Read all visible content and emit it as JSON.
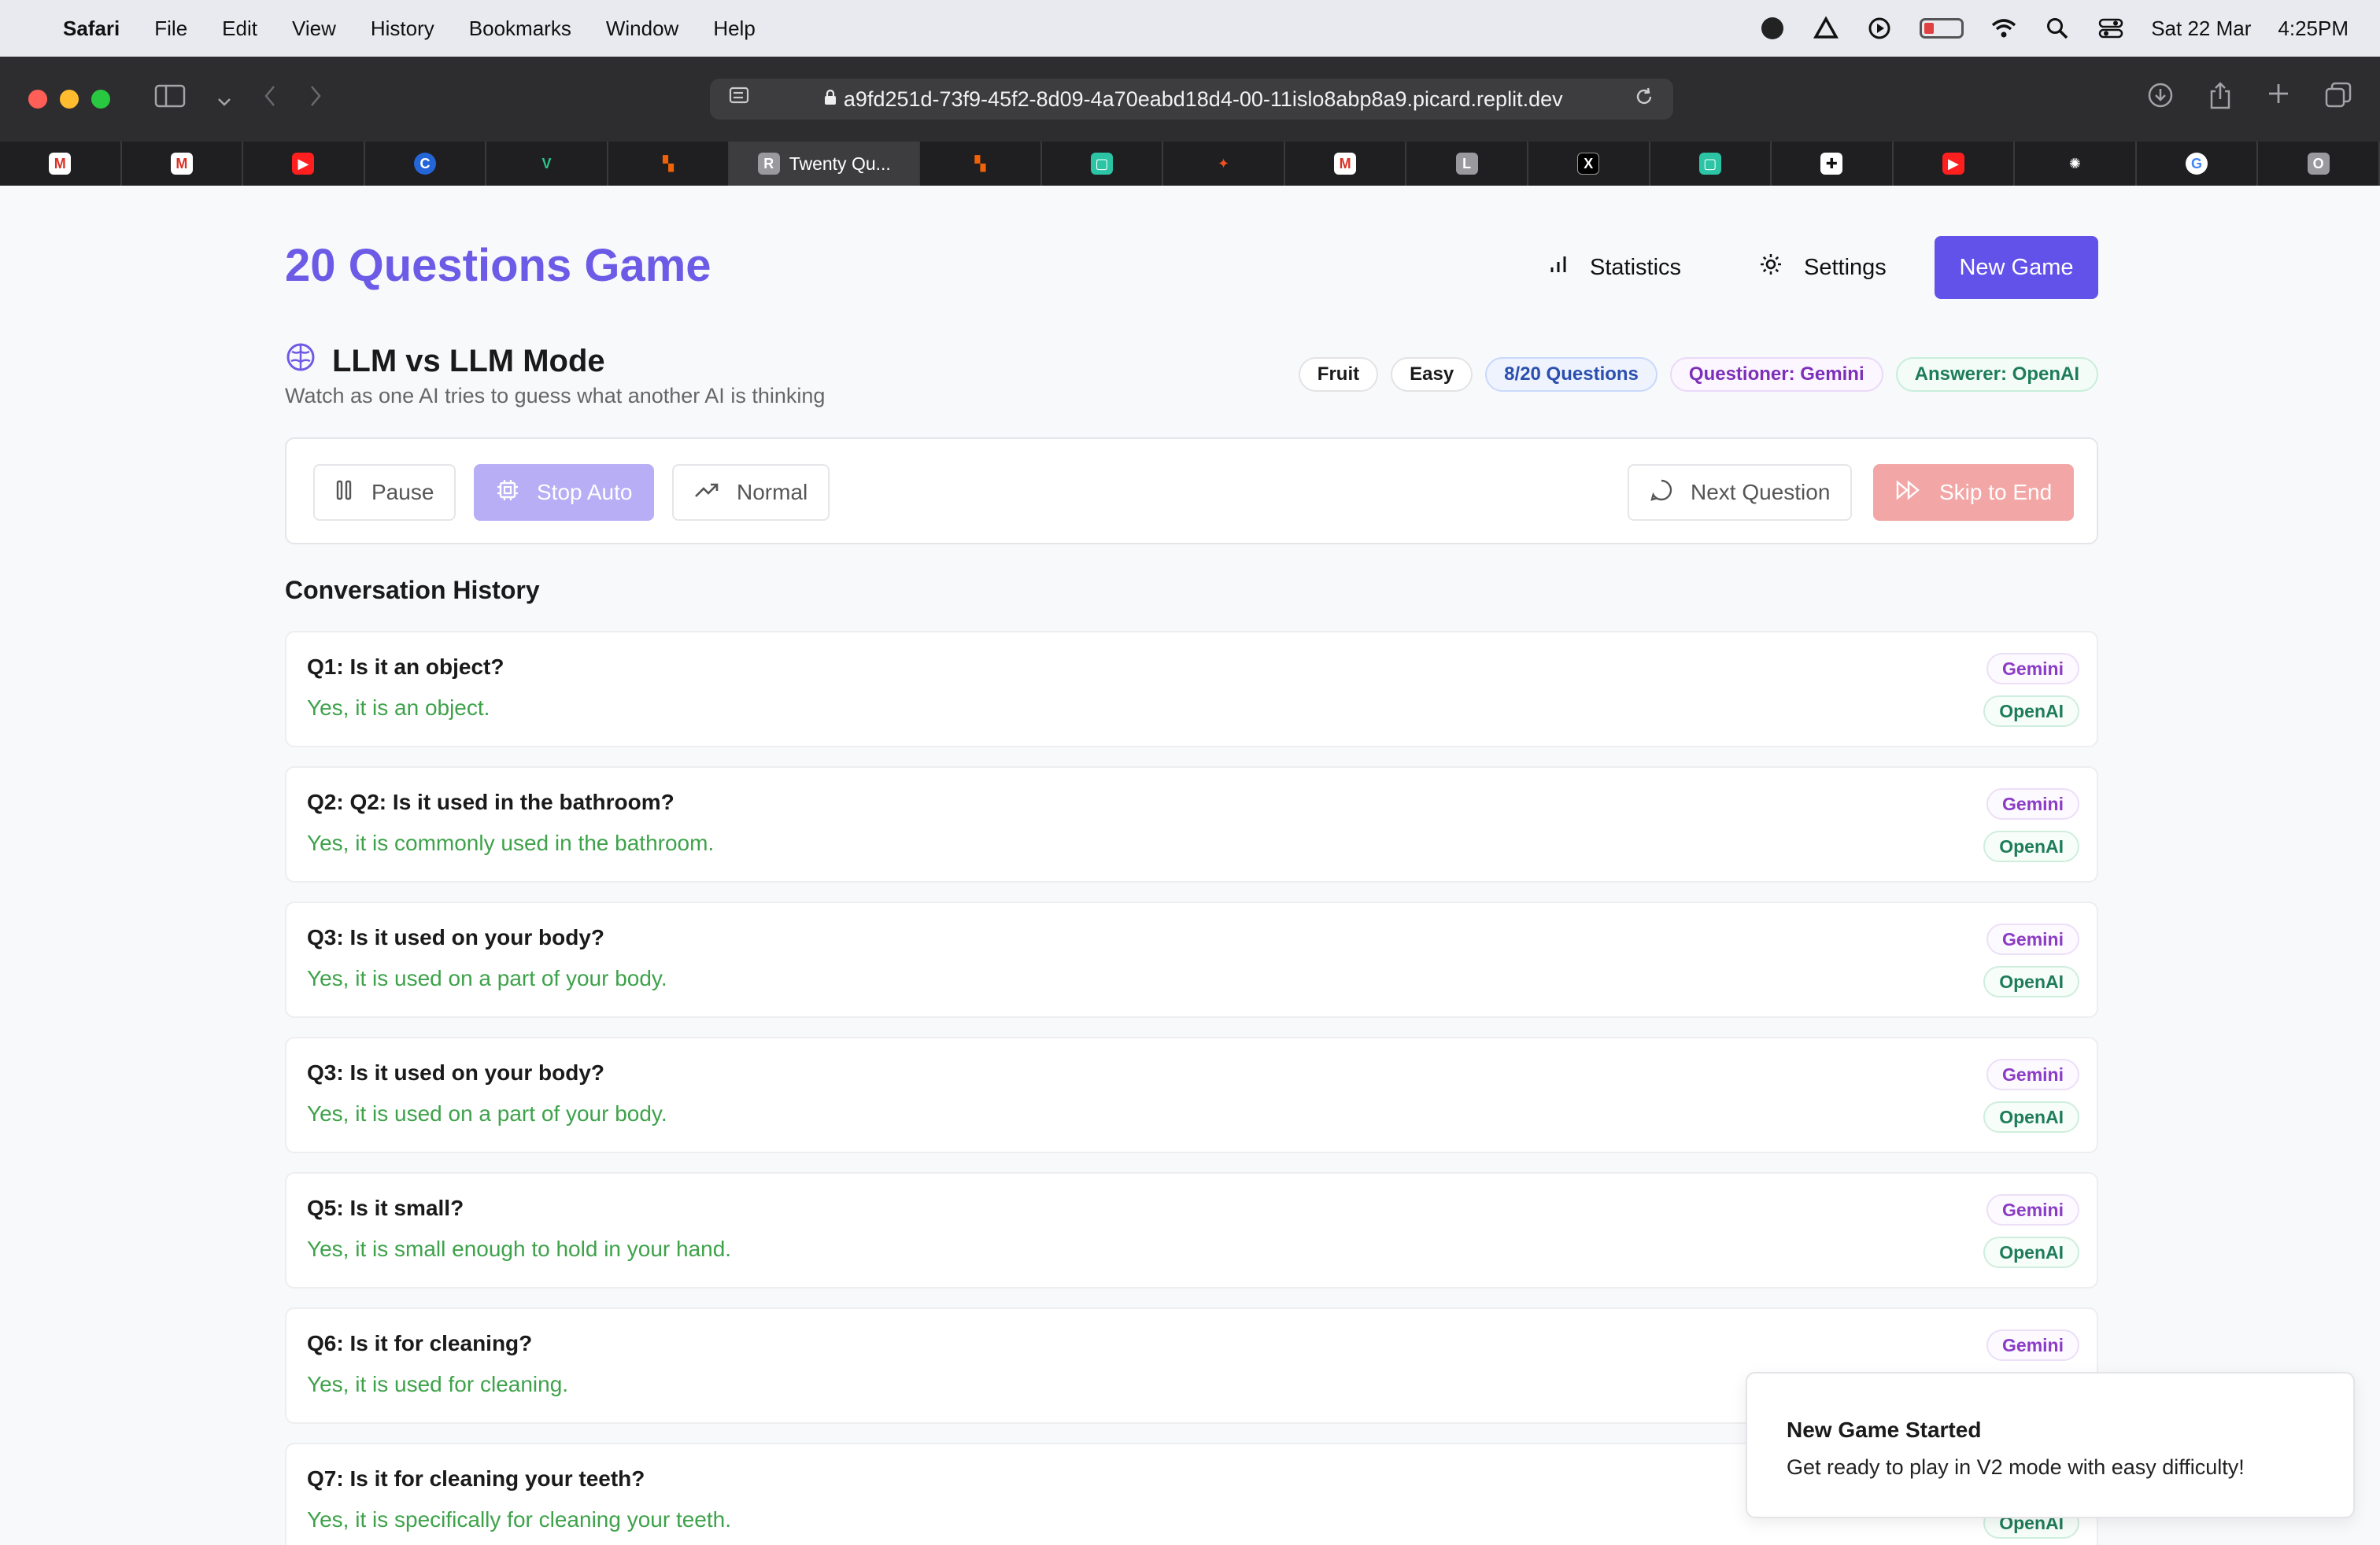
{
  "menubar": {
    "app": "Safari",
    "items": [
      "File",
      "Edit",
      "View",
      "History",
      "Bookmarks",
      "Window",
      "Help"
    ],
    "date": "Sat 22 Mar",
    "time": "4:25PM"
  },
  "browser": {
    "url": "a9fd251d-73f9-45f2-8d09-4a70eabd18d4-00-11islo8abp8a9.picard.replit.dev",
    "active_tab": "Twenty Qu...",
    "active_tab_letter": "R"
  },
  "header": {
    "title": "20 Questions Game",
    "statistics_label": "Statistics",
    "settings_label": "Settings",
    "new_game_label": "New Game"
  },
  "mode": {
    "title": "LLM vs LLM Mode",
    "subtitle": "Watch as one AI tries to guess what another AI is thinking",
    "badges": {
      "category": "Fruit",
      "difficulty": "Easy",
      "progress": "8/20 Questions",
      "questioner": "Questioner: Gemini",
      "answerer": "Answerer: OpenAI"
    }
  },
  "controls": {
    "pause": "Pause",
    "stop_auto": "Stop Auto",
    "speed": "Normal",
    "next_question": "Next Question",
    "skip_to_end": "Skip to End"
  },
  "conversation": {
    "heading": "Conversation History",
    "questioner_tag": "Gemini",
    "answerer_tag": "OpenAI",
    "items": [
      {
        "q": "Q1: Is it an object?",
        "a": "Yes, it is an object."
      },
      {
        "q": "Q2: Q2: Is it used in the bathroom?",
        "a": "Yes, it is commonly used in the bathroom."
      },
      {
        "q": "Q3: Is it used on your body?",
        "a": "Yes, it is used on a part of your body."
      },
      {
        "q": "Q3: Is it used on your body?",
        "a": "Yes, it is used on a part of your body."
      },
      {
        "q": "Q5: Is it small?",
        "a": "Yes, it is small enough to hold in your hand."
      },
      {
        "q": "Q6: Is it for cleaning?",
        "a": "Yes, it is used for cleaning."
      },
      {
        "q": "Q7: Is it for cleaning your teeth?",
        "a": "Yes, it is specifically for cleaning your teeth."
      }
    ]
  },
  "toast": {
    "title": "New Game Started",
    "message": "Get ready to play in V2 mode with easy difficulty!"
  },
  "colors": {
    "accent": "#6252ea",
    "title": "#6c5be6",
    "answer_green": "#3ea24a",
    "stop_auto_bg": "#b7aef5",
    "skip_bg": "#f3a6a6"
  }
}
